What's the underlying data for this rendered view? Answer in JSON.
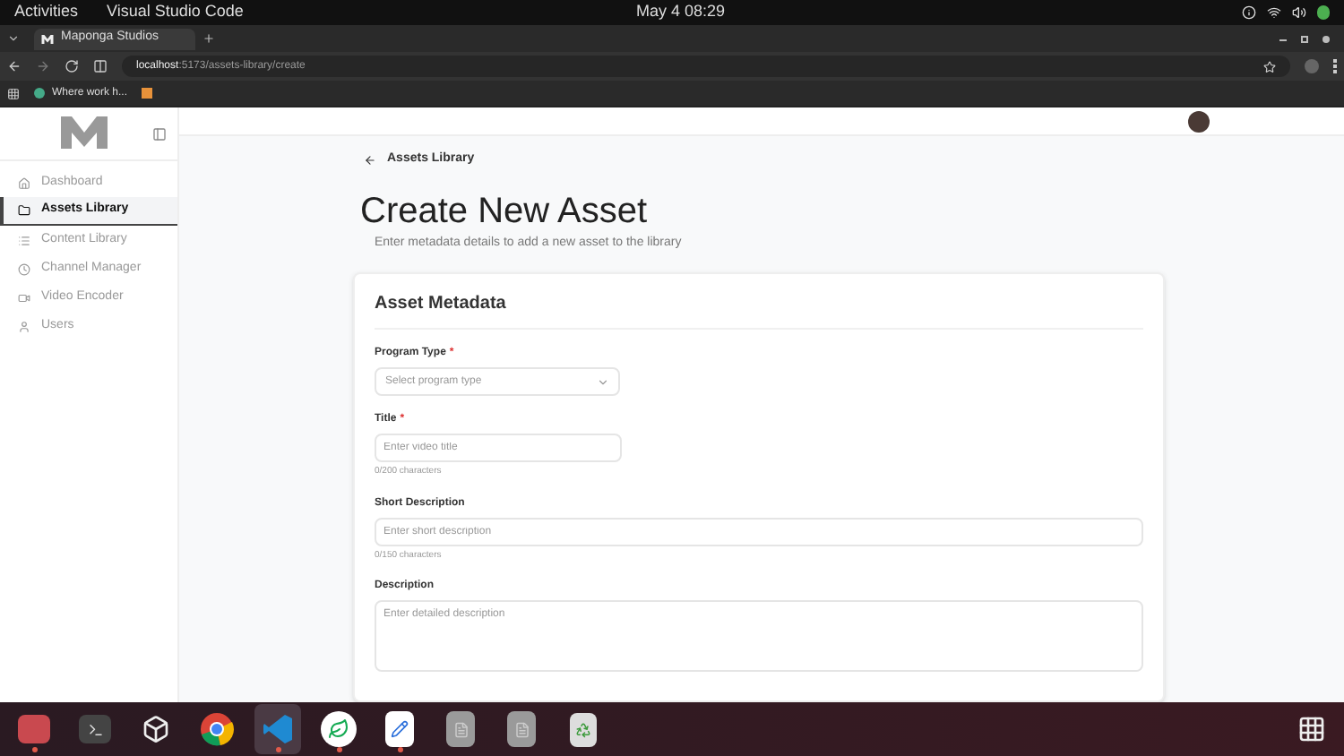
{
  "system_bar": {
    "activities": "Activities",
    "app_name": "Visual Studio Code",
    "clock": "May 4  08:29"
  },
  "browser": {
    "tab_title": "Maponga Studios",
    "url_host": "localhost",
    "url_path": ":5173/assets-library/create",
    "bookmark": "Where work h..."
  },
  "sidebar": {
    "items": [
      {
        "label": "Dashboard",
        "kind": "home",
        "selected": false
      },
      {
        "label": "Assets Library",
        "kind": "folder",
        "selected": true
      },
      {
        "label": "Content Library",
        "kind": "list",
        "selected": false
      },
      {
        "label": "Channel Manager",
        "kind": "clock",
        "selected": false
      },
      {
        "label": "Video Encoder",
        "kind": "video",
        "selected": false
      },
      {
        "label": "Users",
        "kind": "user",
        "selected": false
      }
    ]
  },
  "breadcrumb": "Assets Library",
  "page_title": "Create New Asset",
  "page_subtitle": "Enter metadata details to add a new asset to the library",
  "card": {
    "title": "Asset Metadata",
    "fields": [
      {
        "kind": "select",
        "label": "Program Type",
        "required_mark": "*",
        "placeholder": "Select program type"
      },
      {
        "kind": "input",
        "label": "Title",
        "required_mark": "*",
        "placeholder": "Enter video title",
        "counter": "0/200 characters",
        "wide": false
      },
      {
        "kind": "input",
        "label": "Short Description",
        "placeholder": "Enter short description",
        "counter": "0/150 characters",
        "wide": true
      },
      {
        "kind": "textarea",
        "label": "Description",
        "placeholder": "Enter detailed description"
      }
    ]
  },
  "dock": [
    {
      "kind": "files",
      "running": true,
      "selected": false
    },
    {
      "kind": "terminal",
      "running": false,
      "selected": false
    },
    {
      "kind": "cube",
      "running": false,
      "selected": false
    },
    {
      "kind": "chrome",
      "running": false,
      "selected": false
    },
    {
      "kind": "vscode",
      "running": true,
      "selected": true
    },
    {
      "kind": "leaf",
      "running": true,
      "selected": false
    },
    {
      "kind": "editor",
      "running": true,
      "selected": false
    },
    {
      "kind": "doc",
      "running": false,
      "selected": false
    },
    {
      "kind": "doc",
      "running": false,
      "selected": false
    },
    {
      "kind": "trash",
      "running": false,
      "selected": false
    }
  ]
}
